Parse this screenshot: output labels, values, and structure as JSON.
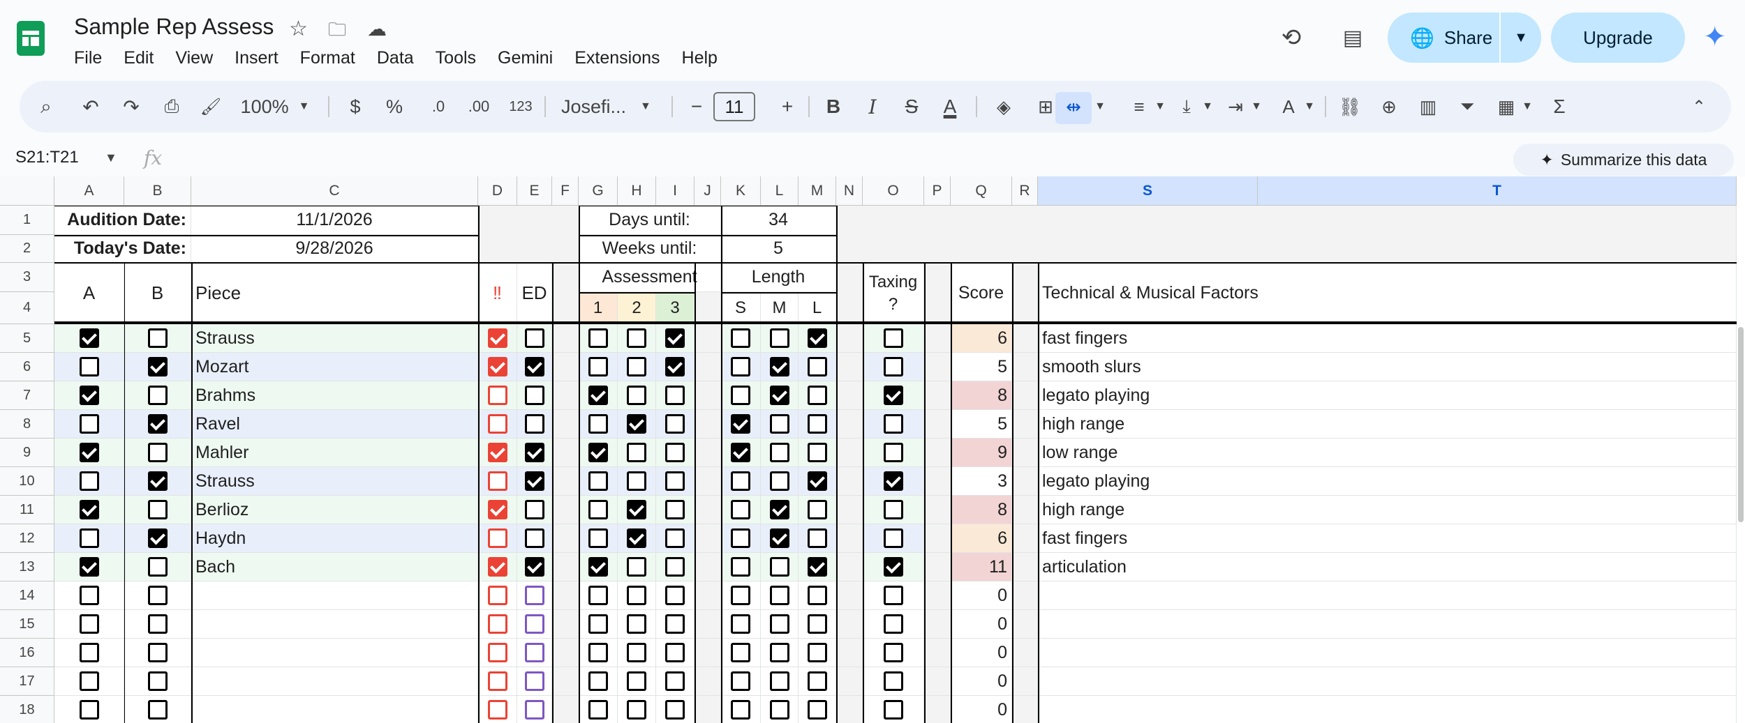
{
  "app": {
    "title": "Sample Rep Assess",
    "menu": [
      "File",
      "Edit",
      "View",
      "Insert",
      "Format",
      "Data",
      "Tools",
      "Gemini",
      "Extensions",
      "Help"
    ],
    "share_label": "Share",
    "upgrade_label": "Upgrade"
  },
  "toolbar": {
    "zoom": "100%",
    "currency": "$",
    "percent": "%",
    "dec_less": ".0",
    "dec_more": ".00",
    "number_format": "123",
    "font": "Josefi...",
    "font_size": "11"
  },
  "formula_bar": {
    "name_box": "S21:T21",
    "fx": "fx",
    "summarize": "Summarize this data"
  },
  "columns": [
    "A",
    "B",
    "C",
    "D",
    "E",
    "F",
    "G",
    "H",
    "I",
    "J",
    "K",
    "L",
    "M",
    "N",
    "O",
    "P",
    "Q",
    "R",
    "S",
    "T"
  ],
  "rows": [
    "1",
    "2",
    "3",
    "4",
    "5",
    "6",
    "7",
    "8",
    "9",
    "10",
    "11",
    "12",
    "13",
    "14",
    "15",
    "16",
    "17",
    "18"
  ],
  "header": {
    "audition_label": "Audition Date:",
    "audition_date": "11/1/2026",
    "today_label": "Today's Date:",
    "today_date": "9/28/2026",
    "days_label": "Days until:",
    "days_value": "34",
    "weeks_label": "Weeks until:",
    "weeks_value": "5",
    "col_a": "A",
    "col_b": "B",
    "piece": "Piece",
    "urgent": "‼",
    "ed": "ED",
    "assessment": "Assessment",
    "assess_1": "1",
    "assess_2": "2",
    "assess_3": "3",
    "length": "Length",
    "len_s": "S",
    "len_m": "M",
    "len_l": "L",
    "taxing": "Taxing ?",
    "score": "Score",
    "factors": "Technical & Musical Factors"
  },
  "pieces": [
    {
      "a": true,
      "b": false,
      "piece": "Strauss",
      "urgent": true,
      "ed": false,
      "a1": false,
      "a2": false,
      "a3": true,
      "s": false,
      "m": false,
      "l": true,
      "tax": false,
      "score": "6",
      "factor": "fast fingers",
      "score_color": "#fbe9d7",
      "row_color": "#eefaf1"
    },
    {
      "a": false,
      "b": true,
      "piece": "Mozart",
      "urgent": true,
      "ed": true,
      "a1": false,
      "a2": false,
      "a3": true,
      "s": false,
      "m": true,
      "l": false,
      "tax": false,
      "score": "5",
      "factor": "smooth slurs",
      "score_color": "#ffffff",
      "row_color": "#e8effb"
    },
    {
      "a": true,
      "b": false,
      "piece": "Brahms",
      "urgent": false,
      "ed": false,
      "a1": true,
      "a2": false,
      "a3": false,
      "s": false,
      "m": true,
      "l": false,
      "tax": true,
      "score": "8",
      "factor": "legato playing",
      "score_color": "#f2d4d4",
      "row_color": "#eefaf1"
    },
    {
      "a": false,
      "b": true,
      "piece": "Ravel",
      "urgent": false,
      "ed": false,
      "a1": false,
      "a2": true,
      "a3": false,
      "s": true,
      "m": false,
      "l": false,
      "tax": false,
      "score": "5",
      "factor": "high range",
      "score_color": "#ffffff",
      "row_color": "#e8effb"
    },
    {
      "a": true,
      "b": false,
      "piece": "Mahler",
      "urgent": true,
      "ed": true,
      "a1": true,
      "a2": false,
      "a3": false,
      "s": true,
      "m": false,
      "l": false,
      "tax": false,
      "score": "9",
      "factor": "low range",
      "score_color": "#f2d4d4",
      "row_color": "#eefaf1"
    },
    {
      "a": false,
      "b": true,
      "piece": "Strauss",
      "urgent": false,
      "ed": true,
      "a1": false,
      "a2": false,
      "a3": false,
      "s": false,
      "m": false,
      "l": true,
      "tax": true,
      "score": "3",
      "factor": "legato playing",
      "score_color": "#ffffff",
      "row_color": "#e8effb"
    },
    {
      "a": true,
      "b": false,
      "piece": "Berlioz",
      "urgent": true,
      "ed": false,
      "a1": false,
      "a2": true,
      "a3": false,
      "s": false,
      "m": true,
      "l": false,
      "tax": false,
      "score": "8",
      "factor": "high range",
      "score_color": "#f2d4d4",
      "row_color": "#eefaf1"
    },
    {
      "a": false,
      "b": true,
      "piece": "Haydn",
      "urgent": false,
      "ed": false,
      "a1": false,
      "a2": true,
      "a3": false,
      "s": false,
      "m": true,
      "l": false,
      "tax": false,
      "score": "6",
      "factor": "fast fingers",
      "score_color": "#fbe9d7",
      "row_color": "#e8effb"
    },
    {
      "a": true,
      "b": false,
      "piece": "Bach",
      "urgent": true,
      "ed": true,
      "a1": true,
      "a2": false,
      "a3": false,
      "s": false,
      "m": false,
      "l": true,
      "tax": true,
      "score": "11",
      "factor": "articulation",
      "score_color": "#f2d4d4",
      "row_color": "#eefaf1"
    },
    {
      "a": false,
      "b": false,
      "piece": "",
      "urgent": false,
      "ed": false,
      "a1": false,
      "a2": false,
      "a3": false,
      "s": false,
      "m": false,
      "l": false,
      "tax": false,
      "score": "0",
      "factor": "",
      "score_color": "#ffffff",
      "row_color": "#ffffff"
    },
    {
      "a": false,
      "b": false,
      "piece": "",
      "urgent": false,
      "ed": false,
      "a1": false,
      "a2": false,
      "a3": false,
      "s": false,
      "m": false,
      "l": false,
      "tax": false,
      "score": "0",
      "factor": "",
      "score_color": "#ffffff",
      "row_color": "#ffffff"
    },
    {
      "a": false,
      "b": false,
      "piece": "",
      "urgent": false,
      "ed": false,
      "a1": false,
      "a2": false,
      "a3": false,
      "s": false,
      "m": false,
      "l": false,
      "tax": false,
      "score": "0",
      "factor": "",
      "score_color": "#ffffff",
      "row_color": "#ffffff"
    },
    {
      "a": false,
      "b": false,
      "piece": "",
      "urgent": false,
      "ed": false,
      "a1": false,
      "a2": false,
      "a3": false,
      "s": false,
      "m": false,
      "l": false,
      "tax": false,
      "score": "0",
      "factor": "",
      "score_color": "#ffffff",
      "row_color": "#ffffff"
    },
    {
      "a": false,
      "b": false,
      "piece": "",
      "urgent": false,
      "ed": false,
      "a1": false,
      "a2": false,
      "a3": false,
      "s": false,
      "m": false,
      "l": false,
      "tax": false,
      "score": "0",
      "factor": "",
      "score_color": "#ffffff",
      "row_color": "#ffffff"
    }
  ],
  "colors": {
    "accent": "#c2e7ff",
    "selected_col": "#d3e3fd",
    "assess_1": "#fce8d4",
    "assess_2": "#fdf3d4",
    "assess_3": "#dcf0d6",
    "urgent_red": "#ea4335",
    "ed_purple": "#7e57c2"
  },
  "icons": [
    "star-icon",
    "move-folder-icon",
    "cloud-status-icon",
    "history-icon",
    "comments-icon",
    "globe-icon",
    "gemini-spark-icon",
    "search-menus-icon",
    "undo-icon",
    "redo-icon",
    "print-icon",
    "paint-format-icon",
    "bold-icon",
    "italic-icon",
    "strikethrough-icon",
    "text-color-icon",
    "fill-color-icon",
    "borders-icon",
    "merge-cells-icon",
    "align-icon",
    "valign-icon",
    "text-wrap-icon",
    "text-rotate-icon",
    "link-icon",
    "comment-icon",
    "chart-icon",
    "filter-icon",
    "table-icon",
    "functions-icon",
    "collapse-icon"
  ]
}
